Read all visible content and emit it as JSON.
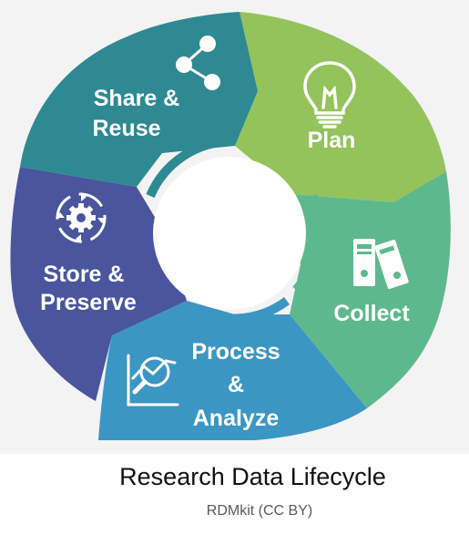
{
  "diagram": {
    "stages": [
      {
        "id": "plan",
        "lines": [
          "Plan"
        ],
        "color": "#93c35a",
        "icon": "lightbulb-icon"
      },
      {
        "id": "collect",
        "lines": [
          "Collect"
        ],
        "color": "#5eb88d",
        "icon": "binders-icon"
      },
      {
        "id": "process",
        "lines": [
          "Process",
          "&",
          "Analyze"
        ],
        "color": "#3b96c4",
        "icon": "magnifier-chart-icon"
      },
      {
        "id": "store",
        "lines": [
          "Store &",
          "Preserve"
        ],
        "color": "#4a559e",
        "icon": "gear-arrows-icon"
      },
      {
        "id": "share",
        "lines": [
          "Share &",
          "Reuse"
        ],
        "color": "#2e8993",
        "icon": "share-icon"
      }
    ]
  },
  "caption": {
    "title": "Research Data Lifecycle",
    "credit": "RDMkit (CC BY)"
  }
}
